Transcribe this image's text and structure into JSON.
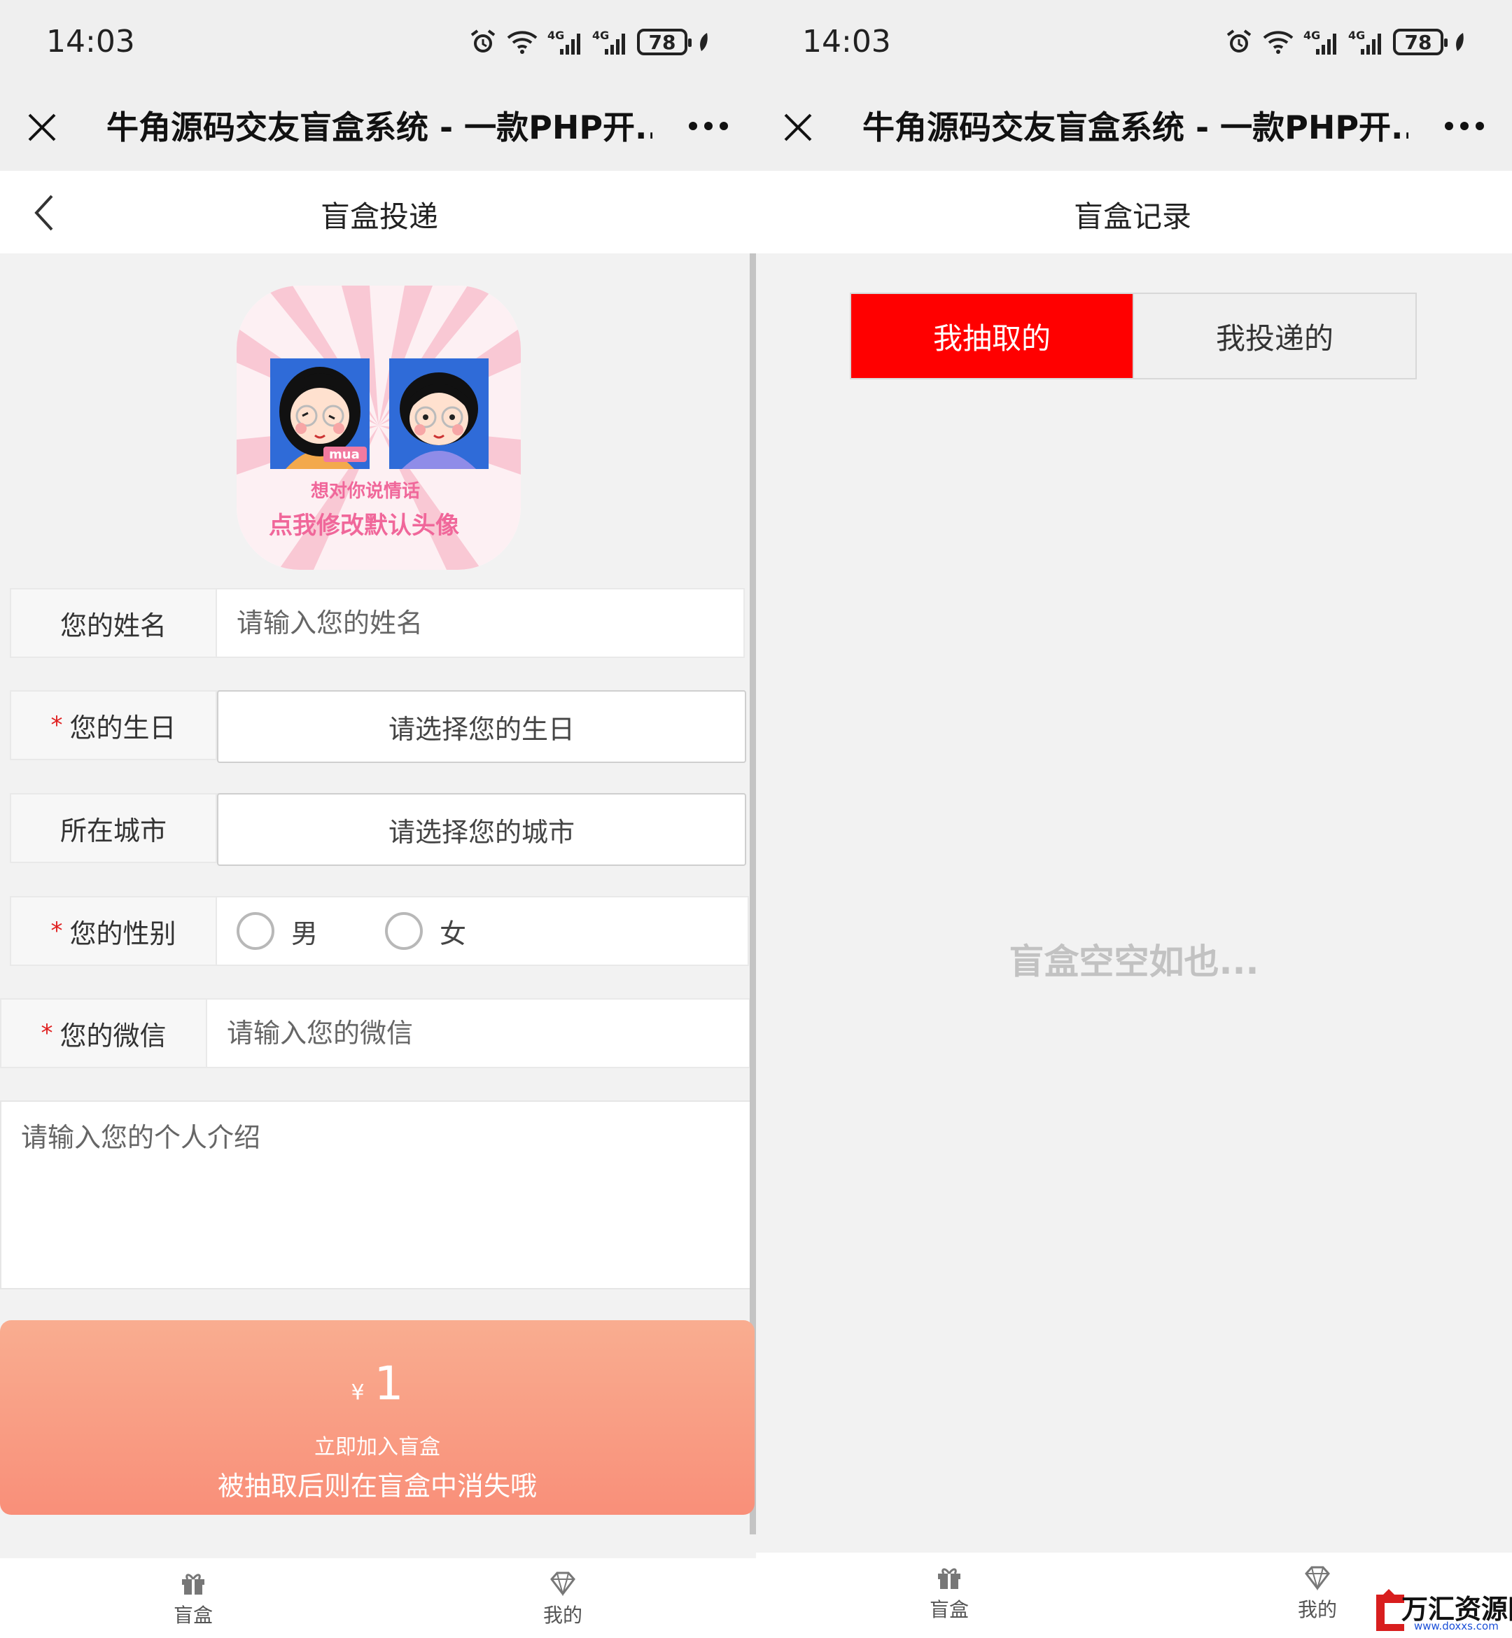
{
  "status": {
    "time": "14:03",
    "battery": "78"
  },
  "wechat": {
    "title": "牛角源码交友盲盒系统 - 一款PHP开..."
  },
  "left": {
    "nav_title": "盲盒投递",
    "form": {
      "name_label": "您的姓名",
      "name_placeholder": "请输入您的姓名",
      "birthday_label": "您的生日",
      "birthday_picker": "请选择您的生日",
      "city_label": "所在城市",
      "city_picker": "请选择您的城市",
      "gender_label": "您的性别",
      "gender_male": "男",
      "gender_female": "女",
      "wechat_label": "您的微信",
      "wechat_placeholder": "请输入您的微信",
      "intro_placeholder": "请输入您的个人介绍",
      "required_mark": "*"
    },
    "avatar": {
      "line1": "想对你说情话",
      "line2": "点我修改默认头像",
      "tag": "mua"
    },
    "submit": {
      "currency": "¥",
      "amount": "1",
      "label": "立即加入盲盒",
      "sub": "被抽取后则在盲盒中消失哦"
    }
  },
  "right": {
    "nav_title": "盲盒记录",
    "tabs": [
      "我抽取的",
      "我投递的"
    ],
    "empty": "盲盒空空如也..."
  },
  "tabbar": {
    "items": [
      "盲盒",
      "我的"
    ]
  },
  "watermark": {
    "text": "万汇资源网",
    "url": "www.doxxs.com"
  },
  "colors": {
    "accent_red": "#ff0000",
    "button_gradient_top": "#f9ad90",
    "button_gradient_bottom": "#f98f79"
  }
}
